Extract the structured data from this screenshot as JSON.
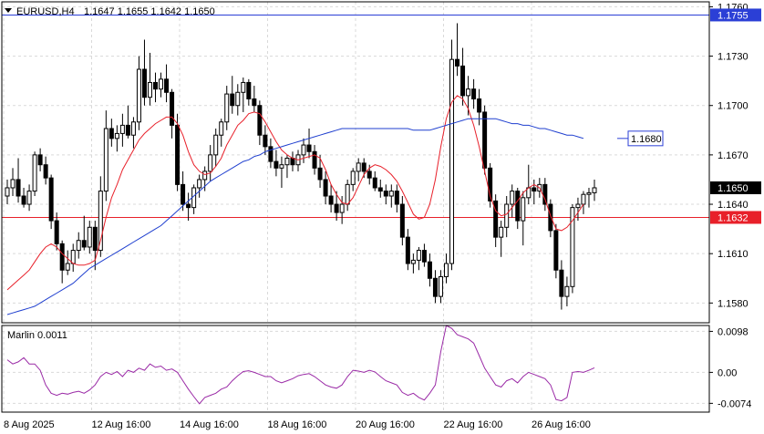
{
  "header": {
    "symbol_label": "EURUSD,H4",
    "ohlc_text": "1.1647 1.1655 1.1642 1.1650",
    "indicator_label": "Marlin 0.0011"
  },
  "colors": {
    "grid": "#d9d9d9",
    "candle": "#000000",
    "ma_fast": "#e8202a",
    "ma_slow": "#1f3fcf",
    "osc": "#9a2aa6",
    "level_red": "#e8202a",
    "level_blue": "#2b3fd6",
    "current_price_bg": "#000000"
  },
  "chart_data": [
    {
      "type": "candlestick",
      "price_ticks": [
        "1.1760",
        "1.1730",
        "1.1700",
        "1.1670",
        "1.1640",
        "1.1610",
        "1.1580"
      ],
      "ylim": [
        1.1568,
        1.1763
      ],
      "time_labels": [
        "8 Aug 2025",
        "12 Aug 16:00",
        "14 Aug 16:00",
        "18 Aug 16:00",
        "20 Aug 16:00",
        "22 Aug 16:00",
        "26 Aug 16:00"
      ],
      "levels": [
        {
          "price": 1.1755,
          "label": "1.1755",
          "color": "level_blue",
          "style": "line"
        },
        {
          "price": 1.1632,
          "label": "1.1632",
          "color": "level_red",
          "style": "line"
        },
        {
          "price": 1.168,
          "label": "1.1680",
          "color": "level_blue",
          "style": "box"
        },
        {
          "price": 1.165,
          "label": "1.1650",
          "color": "current_price_bg",
          "style": "current"
        }
      ],
      "candles": [
        [
          1.1645,
          1.1655,
          1.164,
          1.165
        ],
        [
          1.165,
          1.1662,
          1.1645,
          1.1655
        ],
        [
          1.1655,
          1.1668,
          1.1641,
          1.1645
        ],
        [
          1.1645,
          1.165,
          1.1638,
          1.164
        ],
        [
          1.164,
          1.1652,
          1.1636,
          1.1648
        ],
        [
          1.1648,
          1.1672,
          1.1645,
          1.167
        ],
        [
          1.167,
          1.1674,
          1.166,
          1.1664
        ],
        [
          1.1664,
          1.1669,
          1.1652,
          1.1656
        ],
        [
          1.1656,
          1.1658,
          1.1625,
          1.163
        ],
        [
          1.163,
          1.1635,
          1.1612,
          1.1616
        ],
        [
          1.1616,
          1.1618,
          1.1592,
          1.16
        ],
        [
          1.16,
          1.1612,
          1.1597,
          1.1604
        ],
        [
          1.1604,
          1.1616,
          1.1599,
          1.1612
        ],
        [
          1.1612,
          1.1623,
          1.1607,
          1.1618
        ],
        [
          1.1618,
          1.1633,
          1.1612,
          1.1614
        ],
        [
          1.1614,
          1.163,
          1.161,
          1.1626
        ],
        [
          1.1626,
          1.163,
          1.16,
          1.1612
        ],
        [
          1.1612,
          1.1657,
          1.1608,
          1.1648
        ],
        [
          1.1648,
          1.1697,
          1.1642,
          1.1686
        ],
        [
          1.1686,
          1.1692,
          1.1675,
          1.168
        ],
        [
          1.168,
          1.1688,
          1.1672,
          1.1683
        ],
        [
          1.1683,
          1.1695,
          1.1675,
          1.1688
        ],
        [
          1.1688,
          1.17,
          1.168,
          1.1682
        ],
        [
          1.1682,
          1.1693,
          1.1674,
          1.169
        ],
        [
          1.169,
          1.173,
          1.1685,
          1.1722
        ],
        [
          1.1722,
          1.174,
          1.17,
          1.1705
        ],
        [
          1.1705,
          1.1732,
          1.17,
          1.1714
        ],
        [
          1.1714,
          1.172,
          1.1702,
          1.171
        ],
        [
          1.171,
          1.172,
          1.1705,
          1.1716
        ],
        [
          1.1716,
          1.1725,
          1.1702,
          1.1708
        ],
        [
          1.1708,
          1.171,
          1.168,
          1.1688
        ],
        [
          1.1688,
          1.1695,
          1.1648,
          1.1652
        ],
        [
          1.1652,
          1.166,
          1.1636,
          1.164
        ],
        [
          1.164,
          1.1647,
          1.163,
          1.1638
        ],
        [
          1.1638,
          1.1652,
          1.1634,
          1.165
        ],
        [
          1.165,
          1.1658,
          1.1644,
          1.1655
        ],
        [
          1.1655,
          1.1663,
          1.1648,
          1.166
        ],
        [
          1.166,
          1.1676,
          1.1654,
          1.167
        ],
        [
          1.167,
          1.1686,
          1.1663,
          1.1682
        ],
        [
          1.1682,
          1.1692,
          1.1675,
          1.169
        ],
        [
          1.169,
          1.1712,
          1.1685,
          1.1707
        ],
        [
          1.1707,
          1.1718,
          1.1695,
          1.17
        ],
        [
          1.17,
          1.1713,
          1.1694,
          1.1708
        ],
        [
          1.1708,
          1.1717,
          1.1696,
          1.1714
        ],
        [
          1.1714,
          1.1716,
          1.17,
          1.1704
        ],
        [
          1.1704,
          1.1712,
          1.1696,
          1.17
        ],
        [
          1.17,
          1.1703,
          1.1676,
          1.1682
        ],
        [
          1.1682,
          1.1688,
          1.167,
          1.1675
        ],
        [
          1.1675,
          1.168,
          1.1662,
          1.1666
        ],
        [
          1.1666,
          1.1673,
          1.1657,
          1.1662
        ],
        [
          1.1662,
          1.1669,
          1.165,
          1.1664
        ],
        [
          1.1664,
          1.167,
          1.1656,
          1.1668
        ],
        [
          1.1668,
          1.1672,
          1.166,
          1.1664
        ],
        [
          1.1664,
          1.1673,
          1.166,
          1.167
        ],
        [
          1.167,
          1.168,
          1.1665,
          1.1676
        ],
        [
          1.1676,
          1.1686,
          1.1668,
          1.1672
        ],
        [
          1.1672,
          1.1676,
          1.1658,
          1.1662
        ],
        [
          1.1662,
          1.167,
          1.165,
          1.1655
        ],
        [
          1.1655,
          1.166,
          1.164,
          1.1645
        ],
        [
          1.1645,
          1.1652,
          1.1635,
          1.164
        ],
        [
          1.164,
          1.1648,
          1.163,
          1.1635
        ],
        [
          1.1635,
          1.1645,
          1.1628,
          1.164
        ],
        [
          1.164,
          1.1655,
          1.1636,
          1.1652
        ],
        [
          1.1652,
          1.1662,
          1.1648,
          1.166
        ],
        [
          1.166,
          1.1668,
          1.1654,
          1.1665
        ],
        [
          1.1665,
          1.1668,
          1.1656,
          1.166
        ],
        [
          1.166,
          1.1664,
          1.1652,
          1.1656
        ],
        [
          1.1656,
          1.166,
          1.1648,
          1.165
        ],
        [
          1.165,
          1.1655,
          1.1644,
          1.1648
        ],
        [
          1.1648,
          1.1652,
          1.164,
          1.1645
        ],
        [
          1.1645,
          1.1652,
          1.1638,
          1.1648
        ],
        [
          1.1648,
          1.1652,
          1.1635,
          1.164
        ],
        [
          1.164,
          1.1645,
          1.1615,
          1.162
        ],
        [
          1.162,
          1.1625,
          1.16,
          1.1604
        ],
        [
          1.1604,
          1.161,
          1.1598,
          1.1606
        ],
        [
          1.1606,
          1.1614,
          1.16,
          1.1612
        ],
        [
          1.1612,
          1.1616,
          1.1602,
          1.1605
        ],
        [
          1.1605,
          1.161,
          1.159,
          1.1595
        ],
        [
          1.1595,
          1.16,
          1.158,
          1.1584
        ],
        [
          1.1584,
          1.16,
          1.158,
          1.1596
        ],
        [
          1.1596,
          1.161,
          1.1592,
          1.1604
        ],
        [
          1.1604,
          1.174,
          1.16,
          1.1728
        ],
        [
          1.1728,
          1.175,
          1.1718,
          1.1724
        ],
        [
          1.1724,
          1.1735,
          1.17,
          1.1706
        ],
        [
          1.1706,
          1.1718,
          1.1694,
          1.171
        ],
        [
          1.171,
          1.1716,
          1.1698,
          1.1704
        ],
        [
          1.1704,
          1.171,
          1.1688,
          1.1696
        ],
        [
          1.1696,
          1.17,
          1.1658,
          1.1662
        ],
        [
          1.1662,
          1.1665,
          1.1638,
          1.1642
        ],
        [
          1.1642,
          1.1646,
          1.1614,
          1.162
        ],
        [
          1.162,
          1.163,
          1.1608,
          1.1626
        ],
        [
          1.1626,
          1.1645,
          1.162,
          1.164
        ],
        [
          1.164,
          1.1652,
          1.1632,
          1.1648
        ],
        [
          1.1648,
          1.165,
          1.1625,
          1.163
        ],
        [
          1.163,
          1.1648,
          1.1615,
          1.1644
        ],
        [
          1.1644,
          1.1664,
          1.164,
          1.165
        ],
        [
          1.165,
          1.1655,
          1.164,
          1.1648
        ],
        [
          1.1648,
          1.1656,
          1.1644,
          1.1652
        ],
        [
          1.1652,
          1.1656,
          1.1636,
          1.164
        ],
        [
          1.164,
          1.1643,
          1.162,
          1.1624
        ],
        [
          1.1624,
          1.1628,
          1.1595,
          1.16
        ],
        [
          1.16,
          1.1606,
          1.1576,
          1.1584
        ],
        [
          1.1584,
          1.1596,
          1.1578,
          1.159
        ],
        [
          1.159,
          1.164,
          1.1586,
          1.1638
        ],
        [
          1.1638,
          1.1644,
          1.163,
          1.164
        ],
        [
          1.164,
          1.1648,
          1.1634,
          1.1646
        ],
        [
          1.1646,
          1.165,
          1.1638,
          1.1647
        ],
        [
          1.1647,
          1.1655,
          1.1642,
          1.165
        ]
      ],
      "ma_fast": [
        1.1588,
        1.1591,
        1.1594,
        1.1597,
        1.16,
        1.1605,
        1.161,
        1.1614,
        1.1616,
        1.1614,
        1.161,
        1.1607,
        1.1604,
        1.1603,
        1.1603,
        1.1604,
        1.1606,
        1.1618,
        1.1632,
        1.1644,
        1.1652,
        1.1661,
        1.1667,
        1.1673,
        1.1679,
        1.1683,
        1.1686,
        1.1689,
        1.1691,
        1.1693,
        1.1693,
        1.1689,
        1.1682,
        1.1672,
        1.1664,
        1.166,
        1.1658,
        1.1659,
        1.1663,
        1.1668,
        1.1676,
        1.1682,
        1.1688,
        1.1691,
        1.1695,
        1.1696,
        1.1695,
        1.169,
        1.1684,
        1.1678,
        1.1673,
        1.167,
        1.1668,
        1.1667,
        1.1668,
        1.1669,
        1.167,
        1.1668,
        1.1661,
        1.1652,
        1.1646,
        1.1641,
        1.164,
        1.1644,
        1.1651,
        1.1658,
        1.1662,
        1.1664,
        1.1663,
        1.1661,
        1.1658,
        1.1654,
        1.1648,
        1.1641,
        1.1634,
        1.1631,
        1.1632,
        1.164,
        1.1655,
        1.1675,
        1.1692,
        1.1702,
        1.1706,
        1.1704,
        1.1698,
        1.1688,
        1.1675,
        1.166,
        1.1645,
        1.1636,
        1.1633,
        1.1634,
        1.1638,
        1.1642,
        1.1647,
        1.165,
        1.1652,
        1.165,
        1.1643,
        1.1633,
        1.1625,
        1.1624,
        1.1626,
        1.163,
        1.1635,
        1.164
      ],
      "ma_slow": [
        1.1573,
        1.1574,
        1.1575,
        1.1576,
        1.1577,
        1.1578,
        1.158,
        1.1582,
        1.1584,
        1.1586,
        1.1588,
        1.159,
        1.1592,
        1.1595,
        1.1598,
        1.1601,
        1.1603,
        1.1605,
        1.1607,
        1.1609,
        1.1611,
        1.1613,
        1.1615,
        1.1617,
        1.1619,
        1.1621,
        1.1623,
        1.1625,
        1.1627,
        1.163,
        1.1633,
        1.1636,
        1.1639,
        1.1642,
        1.1645,
        1.1648,
        1.1651,
        1.1654,
        1.1656,
        1.1658,
        1.166,
        1.1662,
        1.1664,
        1.1666,
        1.1667,
        1.1669,
        1.167,
        1.1672,
        1.1673,
        1.1674,
        1.1675,
        1.1676,
        1.1677,
        1.1678,
        1.1679,
        1.168,
        1.1681,
        1.1682,
        1.1683,
        1.1684,
        1.1685,
        1.1686,
        1.1686,
        1.1686,
        1.1686,
        1.1686,
        1.1686,
        1.1686,
        1.1686,
        1.1686,
        1.1686,
        1.1686,
        1.1686,
        1.1686,
        1.1685,
        1.1685,
        1.1685,
        1.1685,
        1.1686,
        1.1687,
        1.1688,
        1.1689,
        1.169,
        1.1691,
        1.1692,
        1.1692,
        1.1692,
        1.1692,
        1.1692,
        1.1692,
        1.1691,
        1.169,
        1.1689,
        1.1689,
        1.1688,
        1.1688,
        1.1687,
        1.1686,
        1.1686,
        1.1685,
        1.1684,
        1.1683,
        1.1682,
        1.1682,
        1.1681,
        1.168
      ],
      "oscillator": {
        "name": "Marlin",
        "ticks": [
          "0.0098",
          "0.00",
          "-0.0074"
        ],
        "ylim": [
          -0.0095,
          0.0112
        ],
        "values": [
          0.003,
          0.002,
          0.0025,
          0.0035,
          0.002,
          0.002,
          0.0005,
          -0.003,
          -0.005,
          -0.0055,
          -0.005,
          -0.0052,
          -0.0048,
          -0.0045,
          -0.005,
          -0.0042,
          -0.003,
          -0.001,
          0.0,
          -0.0005,
          0.0002,
          -0.001,
          0.0005,
          0.0,
          0.001,
          0.0005,
          0.002,
          0.0012,
          0.0015,
          0.0005,
          0.0008,
          0.0,
          -0.002,
          -0.004,
          -0.0058,
          -0.0075,
          -0.006,
          -0.0055,
          -0.005,
          -0.004,
          -0.0035,
          -0.002,
          -0.0008,
          0.0002,
          0.0004,
          0.0,
          -0.0005,
          -0.001,
          -0.001,
          -0.002,
          -0.0025,
          -0.002,
          -0.0015,
          -0.0008,
          -0.0005,
          -0.0003,
          -0.001,
          -0.002,
          -0.003,
          -0.0035,
          -0.0038,
          -0.003,
          -0.001,
          0.0005,
          0.0003,
          0.0,
          0.0005,
          0.0001,
          -0.001,
          -0.002,
          -0.0025,
          -0.003,
          -0.0048,
          -0.0055,
          -0.005,
          -0.006,
          -0.0066,
          -0.005,
          -0.003,
          0.005,
          0.0112,
          0.0105,
          0.009,
          0.0085,
          0.008,
          0.007,
          0.004,
          0.001,
          -0.001,
          -0.003,
          -0.0035,
          -0.002,
          -0.0015,
          -0.0025,
          -0.001,
          0.0,
          -0.0005,
          -0.001,
          -0.0015,
          -0.003,
          -0.0065,
          -0.0068,
          -0.006,
          0.0,
          0.0002,
          0.0,
          0.0005,
          0.0011
        ]
      }
    }
  ]
}
